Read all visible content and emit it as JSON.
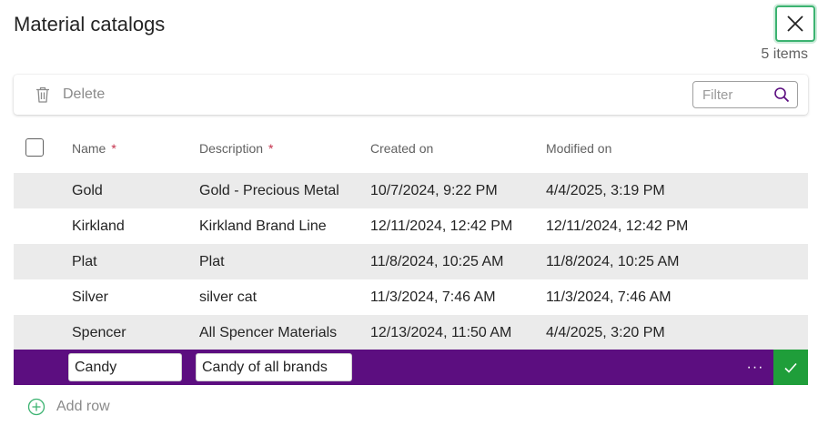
{
  "dialog": {
    "title": "Material catalogs",
    "item_count": "5 items"
  },
  "toolbar": {
    "delete_label": "Delete",
    "filter_placeholder": "Filter"
  },
  "columns": {
    "name": "Name",
    "description": "Description",
    "created": "Created on",
    "modified": "Modified on",
    "required_marker": "*"
  },
  "rows": [
    {
      "name": "Gold",
      "description": "Gold - Precious Metal",
      "created": "10/7/2024, 9:22 PM",
      "modified": "4/4/2025, 3:19 PM"
    },
    {
      "name": "Kirkland",
      "description": "Kirkland Brand Line",
      "created": "12/11/2024, 12:42 PM",
      "modified": "12/11/2024, 12:42 PM"
    },
    {
      "name": "Plat",
      "description": "Plat",
      "created": "11/8/2024, 10:25 AM",
      "modified": "11/8/2024, 10:25 AM"
    },
    {
      "name": "Silver",
      "description": "silver cat",
      "created": "11/3/2024, 7:46 AM",
      "modified": "11/3/2024, 7:46 AM"
    },
    {
      "name": "Spencer",
      "description": "All Spencer Materials",
      "created": "12/13/2024, 11:50 AM",
      "modified": "4/4/2025, 3:20 PM"
    }
  ],
  "edit_row": {
    "name_value": "Candy",
    "description_value": "Candy of all brands",
    "more_label": "···"
  },
  "add_row_label": "Add row",
  "colors": {
    "accent_purple": "#5c0e80",
    "save_green": "#1f9e3a",
    "focus_ring": "#3cb371",
    "required_red": "#c4314b"
  }
}
